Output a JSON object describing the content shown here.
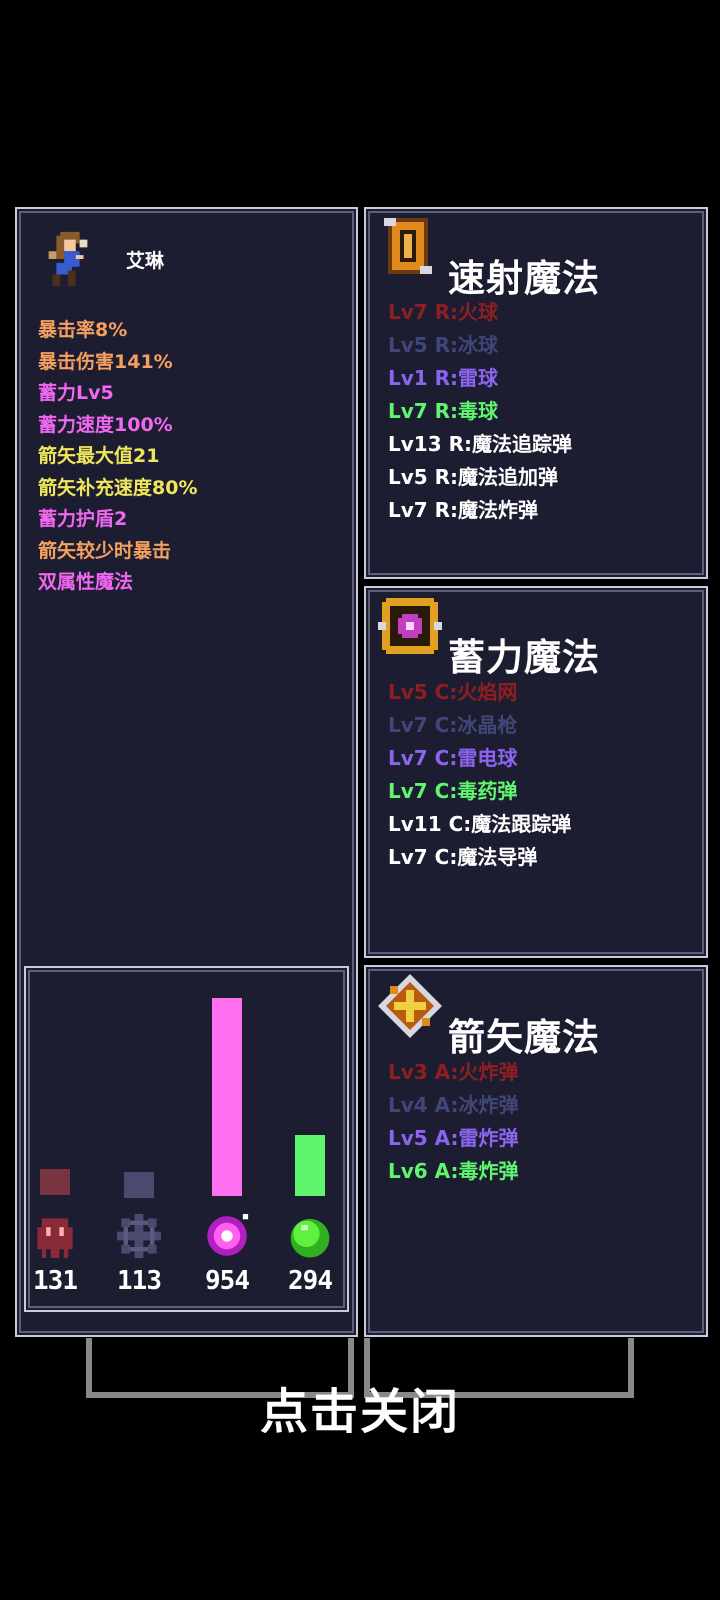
{
  "character": {
    "name": "艾琳",
    "stats": [
      {
        "text": "暴击率8%",
        "color": "#f5a05f"
      },
      {
        "text": "暴击伤害141%",
        "color": "#f5a05f"
      },
      {
        "text": "蓄力Lv5",
        "color": "#f067f0"
      },
      {
        "text": "蓄力速度100%",
        "color": "#f067f0"
      },
      {
        "text": "箭矢最大值21",
        "color": "#f0e65a"
      },
      {
        "text": "箭矢补充速度80%",
        "color": "#f0e65a"
      },
      {
        "text": "蓄力护盾2",
        "color": "#f067f0"
      },
      {
        "text": "箭矢较少时暴击",
        "color": "#f5a05f"
      },
      {
        "text": "双属性魔法",
        "color": "#f067f0"
      }
    ]
  },
  "damage": {
    "bars": [
      {
        "element": "fire",
        "icon": "fire-ghost-icon",
        "value": "131",
        "fraction": 0.14,
        "color": "#7a3340"
      },
      {
        "element": "ice",
        "icon": "ice-snowflake-icon",
        "value": "113",
        "fraction": 0.12,
        "color": "#4a4a6e"
      },
      {
        "element": "thunder",
        "icon": "thunder-orb-icon",
        "value": "954",
        "fraction": 1.0,
        "color": "#ff6fef"
      },
      {
        "element": "poison",
        "icon": "poison-slime-icon",
        "value": "294",
        "fraction": 0.31,
        "color": "#5ff56e"
      }
    ]
  },
  "rapid": {
    "title": "速射魔法",
    "icon": "scroll-icon",
    "spells": [
      {
        "text": "Lv7 R:火球",
        "color": "#8e1e22"
      },
      {
        "text": "Lv5 R:冰球",
        "color": "#414678"
      },
      {
        "text": "Lv1 R:雷球",
        "color": "#8c64f0"
      },
      {
        "text": "Lv7 R:毒球",
        "color": "#5ff56e"
      },
      {
        "text": "Lv13 R:魔法追踪弹",
        "color": "#ffffff"
      },
      {
        "text": "Lv5 R:魔法追加弹",
        "color": "#ffffff"
      },
      {
        "text": "Lv7 R:魔法炸弹",
        "color": "#ffffff"
      }
    ]
  },
  "charge": {
    "title": "蓄力魔法",
    "icon": "charge-crystal-icon",
    "spells": [
      {
        "text": "Lv5 C:火焰网",
        "color": "#8e1e22"
      },
      {
        "text": "Lv7 C:冰晶枪",
        "color": "#414678"
      },
      {
        "text": "Lv7 C:雷电球",
        "color": "#8c64f0"
      },
      {
        "text": "Lv7 C:毒药弹",
        "color": "#5ff56e"
      },
      {
        "text": "Lv11 C:魔法跟踪弹",
        "color": "#ffffff"
      },
      {
        "text": "Lv7 C:魔法导弹",
        "color": "#ffffff"
      }
    ]
  },
  "arrow": {
    "title": "箭矢魔法",
    "icon": "arrow-emblem-icon",
    "spells": [
      {
        "text": "Lv3 A:火炸弹",
        "color": "#8e1e22"
      },
      {
        "text": "Lv4 A:冰炸弹",
        "color": "#414678"
      },
      {
        "text": "Lv5 A:雷炸弹",
        "color": "#8c64f0"
      },
      {
        "text": "Lv6 A:毒炸弹",
        "color": "#5ff56e"
      }
    ]
  },
  "close_label": "点击关闭"
}
